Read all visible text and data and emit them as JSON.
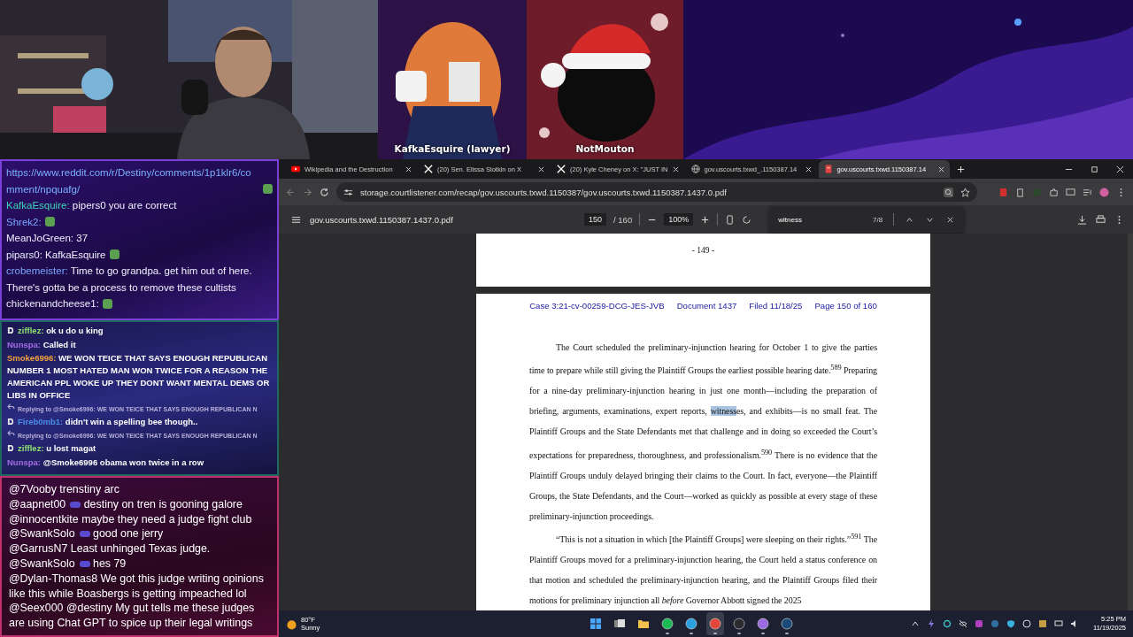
{
  "stream": {
    "guests": [
      {
        "name": "KafkaEsquire (lawyer)"
      },
      {
        "name": "NotMouton"
      }
    ]
  },
  "chat_top": [
    {
      "kind": "link",
      "text": "https://www.reddit.com/r/Destiny/comments/1p1klr6/comment/npquafg/",
      "emote": true
    },
    {
      "kind": "message",
      "user": "KafkaEsquire:",
      "color": "#3fd6b5",
      "text": "pipers0 you are correct",
      "emote": false
    },
    {
      "kind": "message",
      "user": "Shrek2:",
      "color": "#7aa8ff",
      "emote": true
    },
    {
      "kind": "message",
      "user": "MeanJoGreen:",
      "color": "#ececff",
      "text": "37",
      "emote": false
    },
    {
      "kind": "message",
      "user": "pipars0:",
      "color": "#ececff",
      "text": "KafkaEsquire",
      "emote": true
    },
    {
      "kind": "message",
      "user": "crobemeister:",
      "color": "#7aa8ff",
      "text": "Time to go grandpa. get him out of here. There's gotta be a process to remove these cultists",
      "emote": false
    },
    {
      "kind": "message",
      "user": "chickenandcheese1:",
      "color": "#ececff",
      "emote": true
    }
  ],
  "chat_middle": [
    {
      "kind": "message",
      "badge": true,
      "user": "zifflez:",
      "color": "#8ee070",
      "text": "ok u do u king"
    },
    {
      "kind": "message",
      "badge": false,
      "user": "Nunspa:",
      "color": "#a56be6",
      "text": "Called it"
    },
    {
      "kind": "message",
      "badge": false,
      "user": "Smoke6996:",
      "color": "#f2a03c",
      "text": "WE WON TEICE THAT SAYS ENOUGH REPUBLICAN NUMBER 1 MOST HATED MAN WON TWICE FOR A REASON THE AMERICAN PPL WOKE UP THEY DONT WANT MENTAL DEMS OR LIBS IN OFFICE"
    },
    {
      "kind": "reply",
      "text": "Replying to @Smoke6996: WE WON TEICE THAT SAYS ENOUGH REPUBLICAN N"
    },
    {
      "kind": "message",
      "badge": true,
      "user": "Fireb0mb1:",
      "color": "#4a8fe8",
      "text": "didn't win a spelling bee though.."
    },
    {
      "kind": "reply",
      "text": "Replying to @Smoke6996: WE WON TEICE THAT SAYS ENOUGH REPUBLICAN N"
    },
    {
      "kind": "message",
      "badge": true,
      "user": "zifflez:",
      "color": "#8ee070",
      "text": "u lost magat"
    },
    {
      "kind": "message",
      "badge": false,
      "user": "Nunspa:",
      "color": "#a56be6",
      "text": "@Smoke6996 obama won twice in a row"
    }
  ],
  "chat_bottom": [
    {
      "user": "@7Vooby",
      "badge": false,
      "text": "trenstiny arc"
    },
    {
      "user": "@aapnet00",
      "badge": true,
      "text": "destiny on tren is gooning galore"
    },
    {
      "user": "@innocentkite",
      "badge": false,
      "text": "maybe they need a judge fight club"
    },
    {
      "user": "@SwankSolo",
      "badge": true,
      "text": "good one jerry"
    },
    {
      "user": "@GarrusN7",
      "badge": false,
      "text": "Least unhinged Texas judge."
    },
    {
      "user": "@SwankSolo",
      "badge": true,
      "text": "hes 79"
    },
    {
      "user": "@Dylan-Thomas8",
      "badge": false,
      "text": "We got this judge writing opinions like this while Boasbergs is getting impeached lol"
    },
    {
      "user": "@Seex000",
      "badge": false,
      "text": "@destiny My gut tells me these judges are using Chat GPT to spice up their legal writings"
    }
  ],
  "browser": {
    "tabs": [
      {
        "kind": "video",
        "title": "Wikipedia and the Destruction",
        "selected": false
      },
      {
        "kind": "post",
        "title": "(20) Sen. Elissa Slotkin on X",
        "selected": false
      },
      {
        "kind": "post",
        "title": "(20) Kyle Cheney on X: \"JUST IN",
        "selected": false
      },
      {
        "kind": "web",
        "title": "gov.uscourts.txwd_.1150387.14",
        "selected": false
      },
      {
        "kind": "pdf",
        "title": "gov.uscourts.txwd.1150387.14",
        "selected": true
      }
    ],
    "address": "storage.courtlistener.com/recap/gov.uscourts.txwd.1150387/gov.uscourts.txwd.1150387.1437.0.pdf",
    "pdf_toolbar": {
      "file_name": "gov.uscourts.txwd.1150387.1437.0.pdf",
      "page": "150",
      "page_total": "/ 160",
      "zoom": "100%"
    },
    "find_bar": {
      "value": "witness",
      "count": "7/8"
    },
    "previous_page_footer": "- 149 -",
    "page_header": [
      "Case 3:21-cv-00259-DCG-JES-JVB",
      "Document 1437",
      "Filed 11/18/25",
      "Page 150 of 160"
    ],
    "paragraphs": [
      {
        "parts": [
          {
            "text": "The Court scheduled the preliminary-injunction hearing for October 1 to give the parties time to prepare while still giving the Plaintiff Groups the earliest possible hearing date.$^{589}$ Preparing for a nine-day preliminary-injunction hearing in just one month—including the preparation of briefing, arguments, examinations, expert reports, ",
            "highlighted": false
          },
          {
            "text": "witness",
            "highlighted": true
          },
          {
            "text": "es, and exhibits—is no small feat. The Plaintiff Groups and the State Defendants met that challenge and in doing so exceeded the Court’s expectations for preparedness, thoroughness, and professionalism.$^{590}$ There is no evidence that the Plaintiff Groups unduly delayed bringing their claims to the Court. In fact, everyone—the Plaintiff Groups, the State Defendants, and the Court—worked as quickly as possible at every stage of these preliminary-injunction proceedings.",
            "highlighted": false
          }
        ]
      },
      {
        "parts": [
          {
            "text": "“This is not a situation in which [the Plaintiff Groups] were sleeping on their rights.”$^{591}$ The Plaintiff Groups moved for a preliminary-injunction hearing, the Court held a status conference on that motion and scheduled the preliminary-injunction hearing, and the Plaintiff Groups filed their motions for preliminary injunction all *before* Governor Abbott signed the 2025",
            "highlighted": false
          }
        ]
      }
    ]
  },
  "taskbar": {
    "weather": {
      "temperature": "80°F",
      "condition": "Sunny"
    },
    "apps": [
      {
        "kind": "start",
        "running": false
      },
      {
        "kind": "taskview",
        "running": false
      },
      {
        "kind": "folder",
        "running": false
      },
      {
        "kind": "spotify",
        "running": true
      },
      {
        "kind": "edge",
        "running": true
      },
      {
        "kind": "chrome",
        "running": true
      },
      {
        "kind": "obs",
        "running": true
      },
      {
        "kind": "crystal",
        "running": true
      },
      {
        "kind": "steam",
        "running": true
      }
    ],
    "time": "5:25 PM",
    "date": "11/19/2025"
  }
}
